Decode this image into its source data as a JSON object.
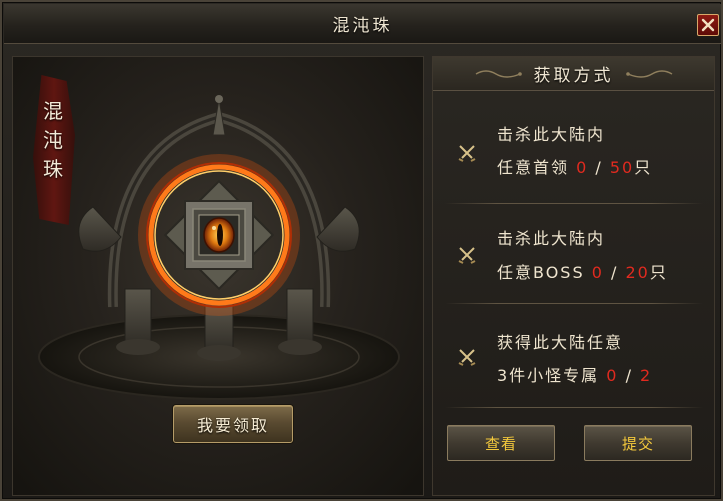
{
  "window": {
    "title": "混沌珠",
    "close_icon": "close-x-icon"
  },
  "item": {
    "vertical_name": "混沌珠",
    "claim_button_label": "我要领取",
    "icon": "demon-eye-orb-icon"
  },
  "acquire": {
    "header": "获取方式",
    "tasks": [
      {
        "line1": "击杀此大陆内",
        "line2_prefix": "任意首领",
        "current": "0",
        "separator": "/",
        "target": "50",
        "unit": "只"
      },
      {
        "line1": "击杀此大陆内",
        "line2_prefix": "任意BOSS",
        "current": "0",
        "separator": "/",
        "target": "20",
        "unit": "只"
      },
      {
        "line1": "获得此大陆任意",
        "line2_prefix": "3件小怪专属",
        "current": "0",
        "separator": "/",
        "target": "2",
        "unit": ""
      }
    ],
    "view_button_label": "查看",
    "submit_button_label": "提交"
  },
  "colors": {
    "accent_gold": "#f4c93c",
    "count_red": "#e02a1f",
    "ring_fire": "#ff7a1a"
  }
}
